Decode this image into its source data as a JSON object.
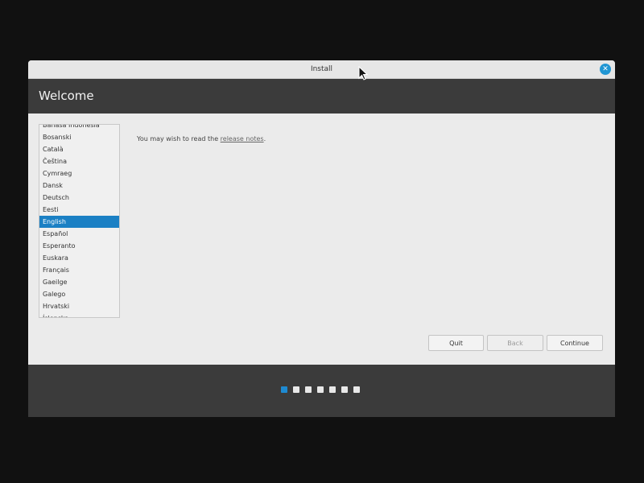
{
  "window": {
    "title": "Install"
  },
  "header": {
    "title": "Welcome"
  },
  "languages": {
    "items": [
      "Bahasa Indonesia",
      "Bosanski",
      "Català",
      "Čeština",
      "Cymraeg",
      "Dansk",
      "Deutsch",
      "Eesti",
      "English",
      "Español",
      "Esperanto",
      "Euskara",
      "Français",
      "Gaeilge",
      "Galego",
      "Hrvatski",
      "Íslenska"
    ],
    "selected": "English"
  },
  "notes": {
    "prefix": "You may wish to read the ",
    "link_text": "release notes",
    "suffix": "."
  },
  "buttons": {
    "quit": "Quit",
    "back": "Back",
    "continue": "Continue"
  },
  "progress": {
    "total_steps": 7,
    "current_step": 1
  },
  "colors": {
    "accent": "#1b80c4",
    "header_bg": "#3b3b3b",
    "close_button": "#2196d3"
  }
}
